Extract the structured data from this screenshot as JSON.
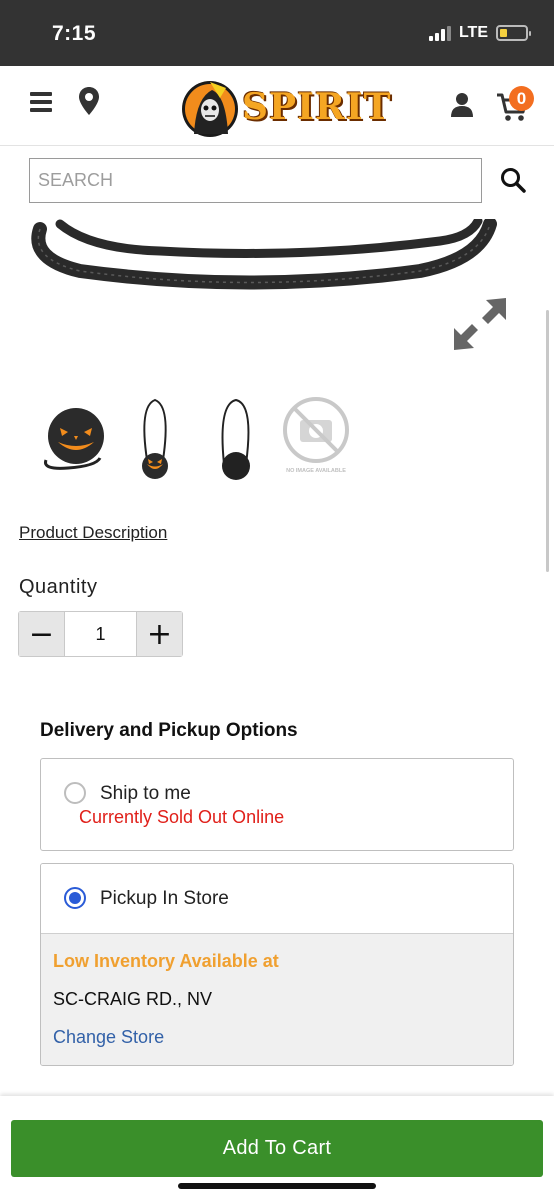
{
  "status_bar": {
    "time": "7:15",
    "network": "LTE"
  },
  "header": {
    "logo_text": "SPIRIT",
    "cart_count": "0",
    "icons": [
      "menu-icon",
      "location-pin-icon",
      "user-icon",
      "cart-icon"
    ]
  },
  "search": {
    "placeholder": "SEARCH",
    "value": ""
  },
  "gallery": {
    "thumbnails": [
      "pumpkin-bag-front",
      "pumpkin-bag-with-strap",
      "bag-back-with-strap",
      "no-image-available"
    ],
    "no_image_text": "NO IMAGE AVAILABLE"
  },
  "product_description_link": "Product Description",
  "quantity": {
    "label": "Quantity",
    "value": "1",
    "minus": "−",
    "plus": "+"
  },
  "delivery": {
    "title": "Delivery and Pickup Options",
    "ship": {
      "label": "Ship to me",
      "status": "Currently Sold Out Online",
      "selected": false
    },
    "pickup": {
      "label": "Pickup In Store",
      "selected": true,
      "inventory": "Low Inventory Available at",
      "store": "SC-CRAIG RD., NV",
      "change_store": "Change Store"
    }
  },
  "add_to_cart": "Add To Cart",
  "colors": {
    "accent_green": "#3a8f2a",
    "sold_out_red": "#e0201a",
    "low_inventory_orange": "#f0a030",
    "link_blue": "#3261a8",
    "badge_orange": "#f36e20"
  }
}
